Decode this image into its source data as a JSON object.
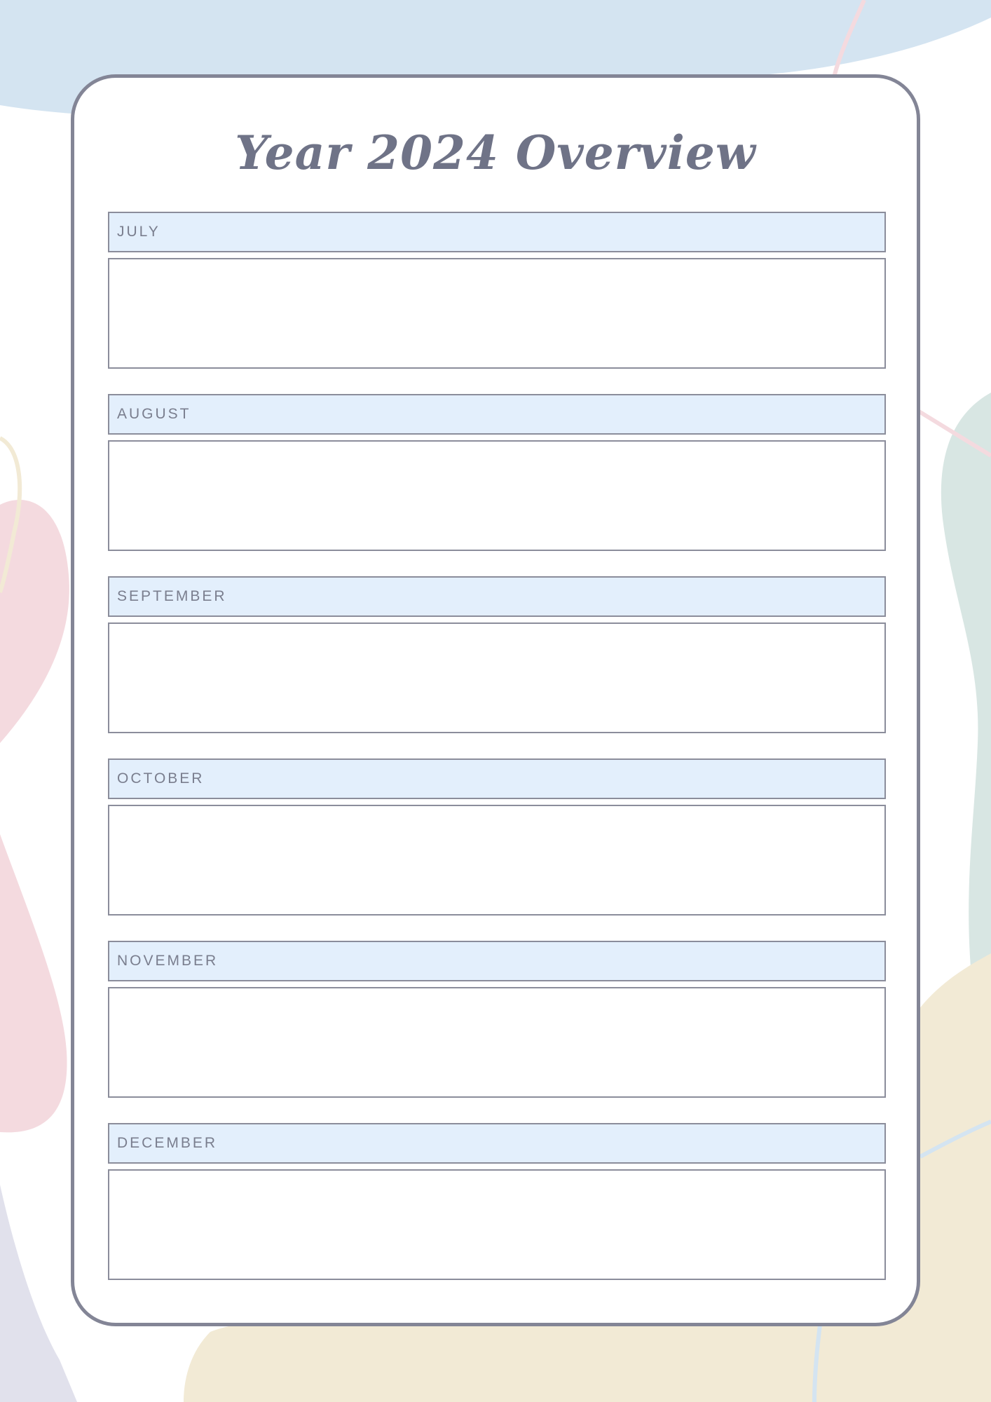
{
  "page": {
    "title": "Year 2024 Overview"
  },
  "months": [
    {
      "label": "JULY"
    },
    {
      "label": "AUGUST"
    },
    {
      "label": "SEPTEMBER"
    },
    {
      "label": "OCTOBER"
    },
    {
      "label": "NOVEMBER"
    },
    {
      "label": "DECEMBER"
    }
  ],
  "colors": {
    "header_fill": "#e3effc",
    "border": "#838596",
    "title_text": "#6f7387",
    "blob_blue": "#d4e4f1",
    "blob_pink": "#f4dadf",
    "blob_green": "#d8e6e3",
    "blob_cream": "#f2ead5",
    "blob_lavender": "#e1e1ec"
  }
}
